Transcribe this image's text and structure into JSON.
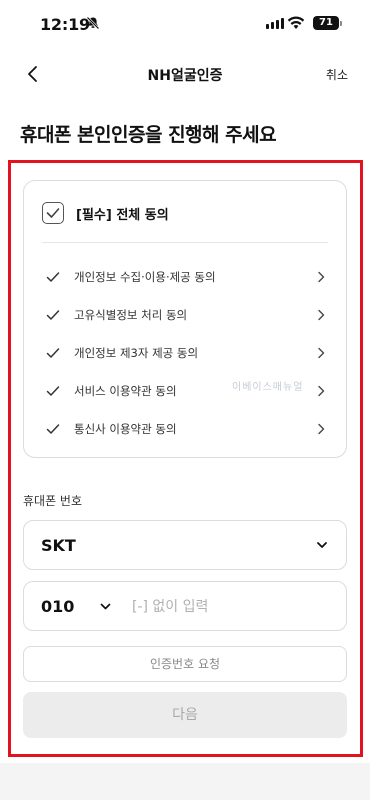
{
  "status_bar": {
    "time": "12:19",
    "battery": "71"
  },
  "header": {
    "title": "NH얼굴인증",
    "cancel": "취소"
  },
  "page_title": "휴대폰 본인인증을 진행해 주세요",
  "consent": {
    "all_label": "[필수] 전체 동의",
    "items": [
      {
        "label": "개인정보 수집·이용·제공 동의"
      },
      {
        "label": "고유식별정보 처리 동의"
      },
      {
        "label": "개인정보 제3자 제공 동의"
      },
      {
        "label": "서비스 이용약관 동의"
      },
      {
        "label": "통신사 이용약관 동의"
      }
    ]
  },
  "watermark": "이베이스매뉴얼",
  "phone": {
    "label": "휴대폰 번호",
    "carrier": "SKT",
    "prefix": "010",
    "placeholder": "[-] 없이 입력",
    "value": ""
  },
  "buttons": {
    "request": "인증번호 요청",
    "next": "다음"
  },
  "colors": {
    "highlight": "#e3121e",
    "disabled_bg": "#ececec",
    "border": "#dcdcdc"
  }
}
